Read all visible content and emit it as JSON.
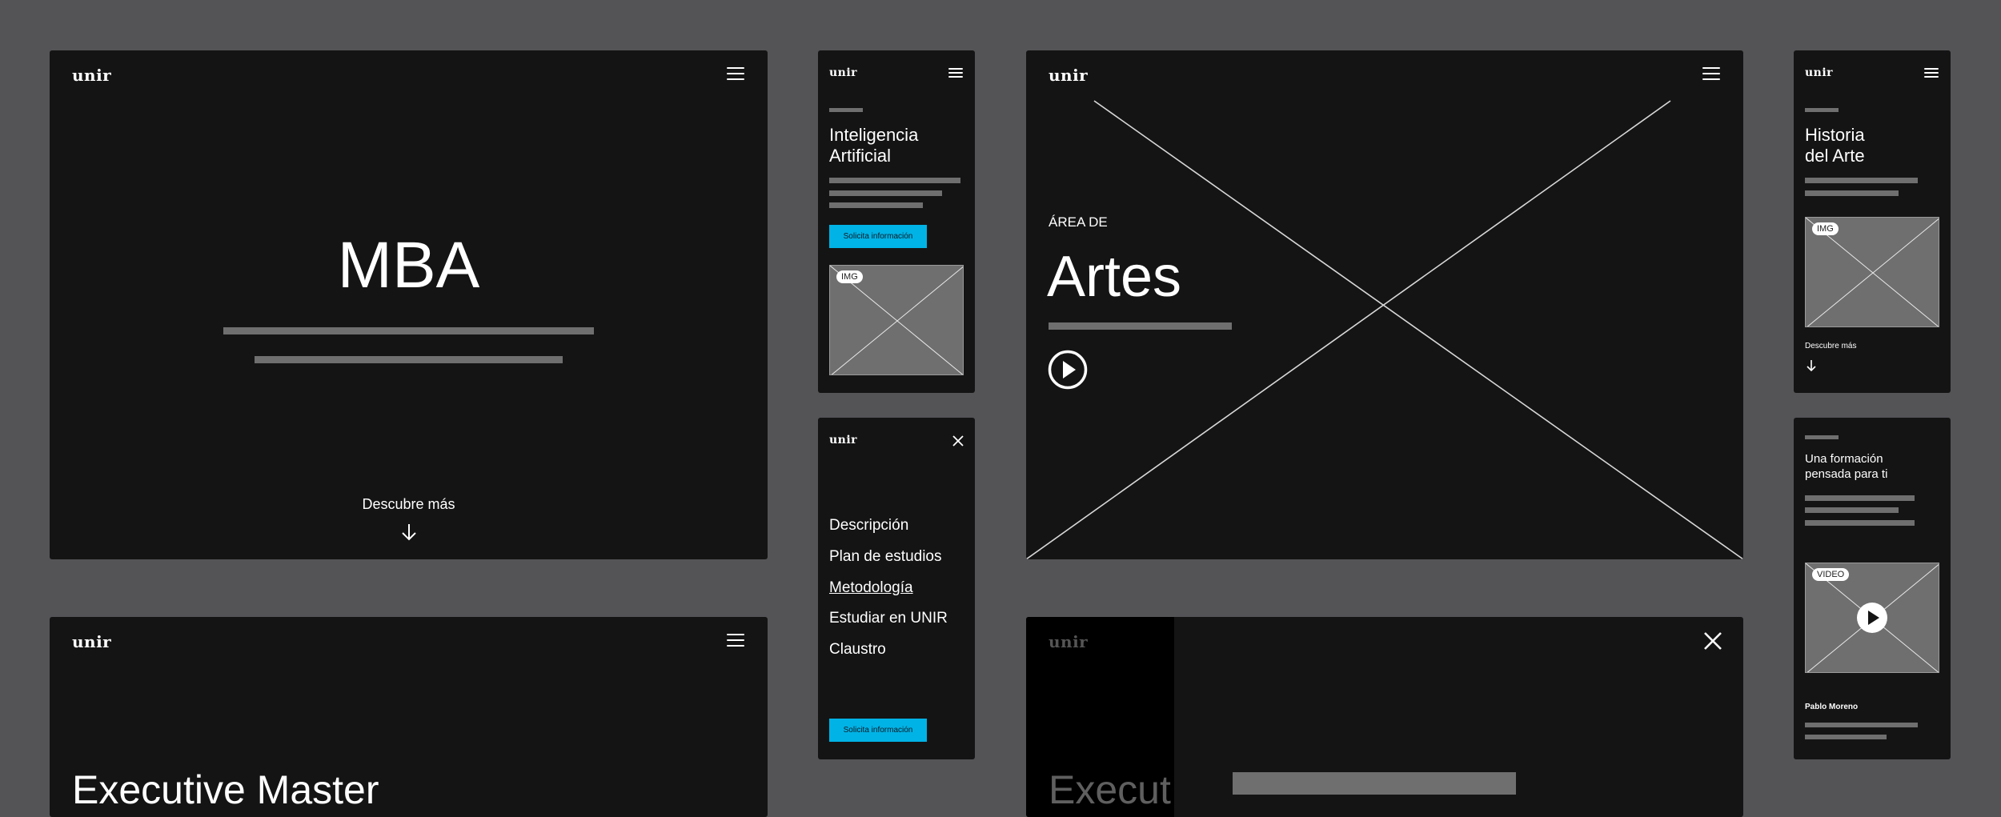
{
  "brand": {
    "logo": "unir"
  },
  "colors": {
    "canvas": "#545457",
    "frame": "#141414",
    "placeholder": "#6f6f6f",
    "accent": "#00b3e6"
  },
  "mba": {
    "title": "MBA",
    "scroll_label": "Descubre más"
  },
  "ia": {
    "title_line1": "Inteligencia",
    "title_line2": "Artificial",
    "cta": "Solicita información",
    "img_tag": "IMG"
  },
  "menu": {
    "items": [
      "Descripción",
      "Plan de estudios",
      "Metodología",
      "Estudiar en UNIR",
      "Claustro"
    ],
    "active_index": 2,
    "cta": "Solicita información"
  },
  "artes": {
    "kicker": "ÁREA DE",
    "title": "Artes"
  },
  "historia": {
    "title_line1": "Historia",
    "title_line2": "del Arte",
    "img_tag": "IMG",
    "scroll_label": "Descubre más"
  },
  "formacion": {
    "title_line1": "Una formación",
    "title_line2": "pensada para ti",
    "video_tag": "VIDEO",
    "author": "Pablo Moreno"
  },
  "executive": {
    "title": "Executive Master"
  },
  "exec_menu": {
    "title_fragment": "Execut"
  }
}
